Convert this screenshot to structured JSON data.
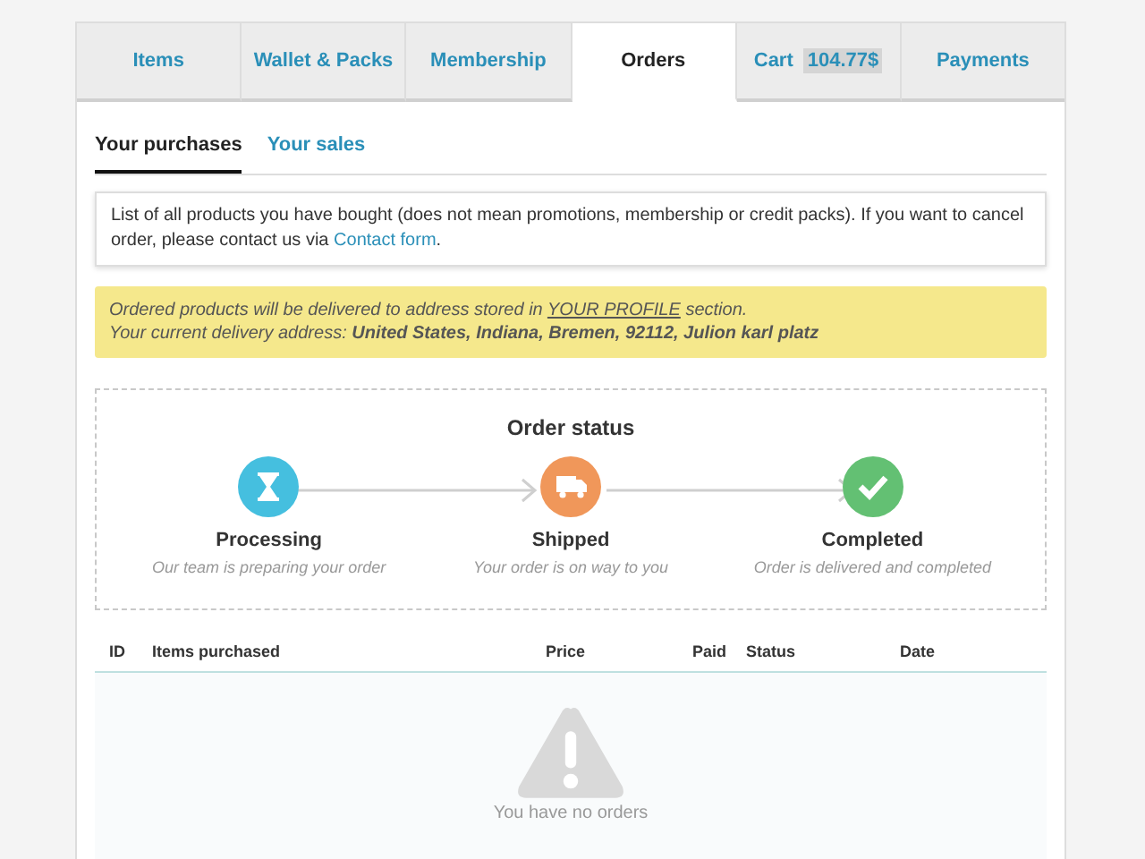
{
  "tabs": [
    {
      "label": "Items",
      "selected": false
    },
    {
      "label": "Wallet & Packs",
      "selected": false
    },
    {
      "label": "Membership",
      "selected": false
    },
    {
      "label": "Orders",
      "selected": true
    },
    {
      "label": "Cart",
      "badge": "104.77$",
      "selected": false
    },
    {
      "label": "Payments",
      "selected": false
    }
  ],
  "subtabs": [
    {
      "label": "Your purchases",
      "selected": true
    },
    {
      "label": "Your sales",
      "selected": false
    }
  ],
  "info": {
    "text": "List of all products you have bought (does not mean promotions, membership or credit packs). If you want to cancel order, please contact us via ",
    "link": "Contact form",
    "after": "."
  },
  "notice": {
    "before": "Ordered products will be delivered to address stored in ",
    "link": "YOUR PROFILE",
    "after": " section.",
    "address_line": "Your current delivery address: **United States, Indiana, Bremen, 92112, Julion karl platz**"
  },
  "order_status": {
    "title": "Order status",
    "steps": [
      {
        "kind": "hourglass",
        "color": "#45bfdf",
        "title": "Processing",
        "caption": "Our team is preparing your order"
      },
      {
        "kind": "truck",
        "color": "#f0975a",
        "title": "Shipped",
        "caption": "Your order is on way to you"
      },
      {
        "kind": "check",
        "color": "#63c073",
        "title": "Completed",
        "caption": "Order is delivered and completed"
      }
    ]
  },
  "table": {
    "columns": [
      "ID",
      "Items purchased",
      "Price",
      "Paid",
      "Status",
      "Date"
    ],
    "empty_text": "You have no orders"
  }
}
